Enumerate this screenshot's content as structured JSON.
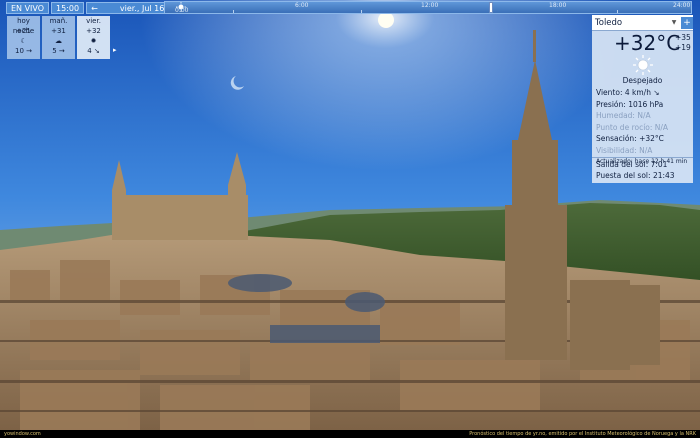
{
  "topbar": {
    "live_label": "EN VIVO",
    "time": "15:00",
    "date_prev": "←",
    "date": "vier., Jul 16",
    "date_next": "→"
  },
  "timeline": {
    "ticks": [
      "0:00",
      "6:00",
      "12:00",
      "18:00",
      "24:00"
    ]
  },
  "forecast": {
    "days": [
      {
        "label": "hoy noche",
        "temp": "+21",
        "wind": "10 →"
      },
      {
        "label": "mañ.",
        "temp": "+31",
        "wind": "5 →"
      },
      {
        "label": "vier.",
        "temp": "+32",
        "wind": "4 ↘"
      }
    ],
    "next": "▸"
  },
  "panel": {
    "city": "Toledo",
    "add": "+",
    "temperature": "+32°C",
    "high": "+35",
    "low": "+19",
    "condition": "Despejado",
    "wind_label": "Viento:",
    "wind_value": "4 km/h ↘",
    "pressure_label": "Presión:",
    "pressure_value": "1016 hPa",
    "humidity_label": "Humedad:",
    "humidity_value": "N/A",
    "dew_label": "Punto de rocío:",
    "dew_value": "N/A",
    "feels_label": "Sensación:",
    "feels_value": "+32°C",
    "visibility_label": "Visibilidad:",
    "visibility_value": "N/A",
    "updated_label": "Actualizado:",
    "updated_value": "hace 12 h 41 min",
    "sunrise_label": "Salida del sol:",
    "sunrise_value": "7:01",
    "sunset_label": "Puesta del sol:",
    "sunset_value": "21:43"
  },
  "footer": {
    "left": "yowindow.com",
    "right": "Pronóstico del tiempo de yr.no, emitido por el Instituto Meteorológico de Noruega y la NRK"
  }
}
